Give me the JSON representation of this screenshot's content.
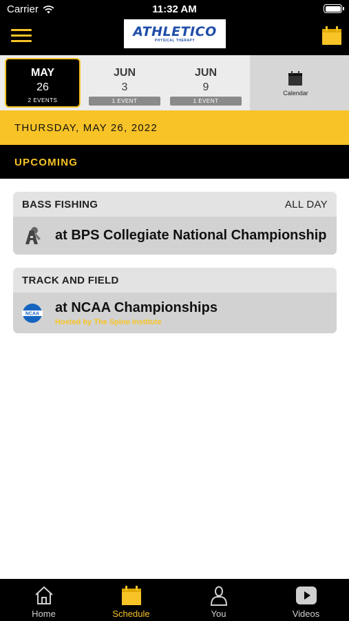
{
  "status_bar": {
    "carrier": "Carrier",
    "time": "11:32 AM"
  },
  "header": {
    "logo_text": "ATHLETICO",
    "logo_subtext": "PHYSICAL THERAPY"
  },
  "date_strip": {
    "dates": [
      {
        "month": "MAY",
        "day": "26",
        "badge": "2 EVENTS",
        "selected": true
      },
      {
        "month": "JUN",
        "day": "3",
        "badge": "1 EVENT",
        "selected": false
      },
      {
        "month": "JUN",
        "day": "9",
        "badge": "1 EVENT",
        "selected": false
      }
    ],
    "calendar_label": "Calendar"
  },
  "date_banner": "THURSDAY, MAY 26, 2022",
  "section_label": "UPCOMING",
  "events": [
    {
      "sport": "BASS FISHING",
      "time": "ALL DAY",
      "title": "at BPS Collegiate National Championship",
      "subtitle": "",
      "logo": "team-logo-icon"
    },
    {
      "sport": "TRACK AND FIELD",
      "time": "",
      "title": "at NCAA Championships",
      "subtitle": "Hosted by The Spine Institute",
      "logo": "ncaa-logo-icon"
    }
  ],
  "ncaa_logo_text": "NCAA",
  "tabs": [
    {
      "label": "Home",
      "icon": "home-icon",
      "active": false
    },
    {
      "label": "Schedule",
      "icon": "schedule-calendar-icon",
      "active": true
    },
    {
      "label": "You",
      "icon": "person-icon",
      "active": false
    },
    {
      "label": "Videos",
      "icon": "play-icon",
      "active": false
    }
  ],
  "colors": {
    "accent": "#f7c327",
    "background": "#000000",
    "card": "#d6d6d6"
  }
}
